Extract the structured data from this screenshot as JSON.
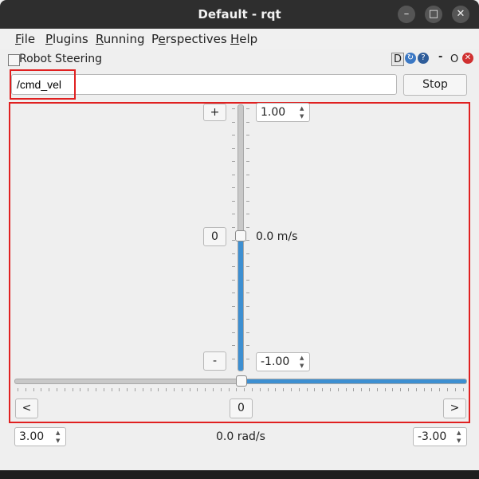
{
  "window": {
    "title": "Default - rqt"
  },
  "menu": [
    {
      "prefix": "",
      "accel": "F",
      "rest": "ile"
    },
    {
      "prefix": "",
      "accel": "P",
      "rest": "lugins"
    },
    {
      "prefix": "",
      "accel": "R",
      "rest": "unning"
    },
    {
      "prefix": "P",
      "accel": "e",
      "rest": "rspectives"
    },
    {
      "prefix": "",
      "accel": "H",
      "rest": "elp"
    }
  ],
  "plugin": {
    "title": "Robot Steering",
    "d_label": "D",
    "dash": "-",
    "o_label": "O"
  },
  "topic": {
    "value": "/cmd_vel",
    "stop_label": "Stop"
  },
  "linear": {
    "plus_label": "+",
    "zero_label": "0",
    "minus_label": "-",
    "max_value": "1.00",
    "min_value": "-1.00",
    "current_text": "0.0 m/s",
    "level": 0.5
  },
  "angular": {
    "left_label": "<",
    "zero_label": "0",
    "right_label": ">",
    "max_value": "3.00",
    "min_value": "-3.00",
    "current_text": "0.0 rad/s",
    "level": 0.5
  },
  "colors": {
    "accent": "#3d8fd1",
    "highlight": "#e02020",
    "titlebar": "#2e2e2e"
  }
}
